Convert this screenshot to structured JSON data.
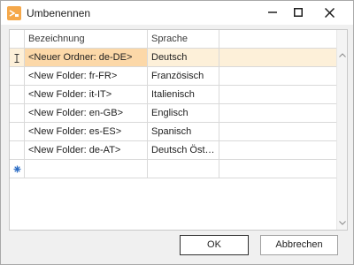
{
  "window": {
    "title": "Umbenennen",
    "app_icon": "rename-folder-icon",
    "accent": "#f5a84a"
  },
  "grid": {
    "columns": [
      "Bezeichnung",
      "Sprache"
    ],
    "rows": [
      {
        "name": "<Neuer Ordner: de-DE>",
        "language": "Deutsch"
      },
      {
        "name": "<New Folder: fr-FR>",
        "language": "Französisch"
      },
      {
        "name": "<New Folder: it-IT>",
        "language": "Italienisch"
      },
      {
        "name": "<New Folder: en-GB>",
        "language": "Englisch"
      },
      {
        "name": "<New Folder: es-ES>",
        "language": "Spanisch"
      },
      {
        "name": "<New Folder: de-AT>",
        "language": "Deutsch Öst…"
      }
    ],
    "active_row_index": 0,
    "edit_indicator": "text-cursor-icon",
    "new_row_indicator": "new-row-icon",
    "active_row_color": "#fdf0d9",
    "active_cell_color": "#fcd8a8"
  },
  "buttons": {
    "ok": "OK",
    "cancel": "Abbrechen"
  }
}
